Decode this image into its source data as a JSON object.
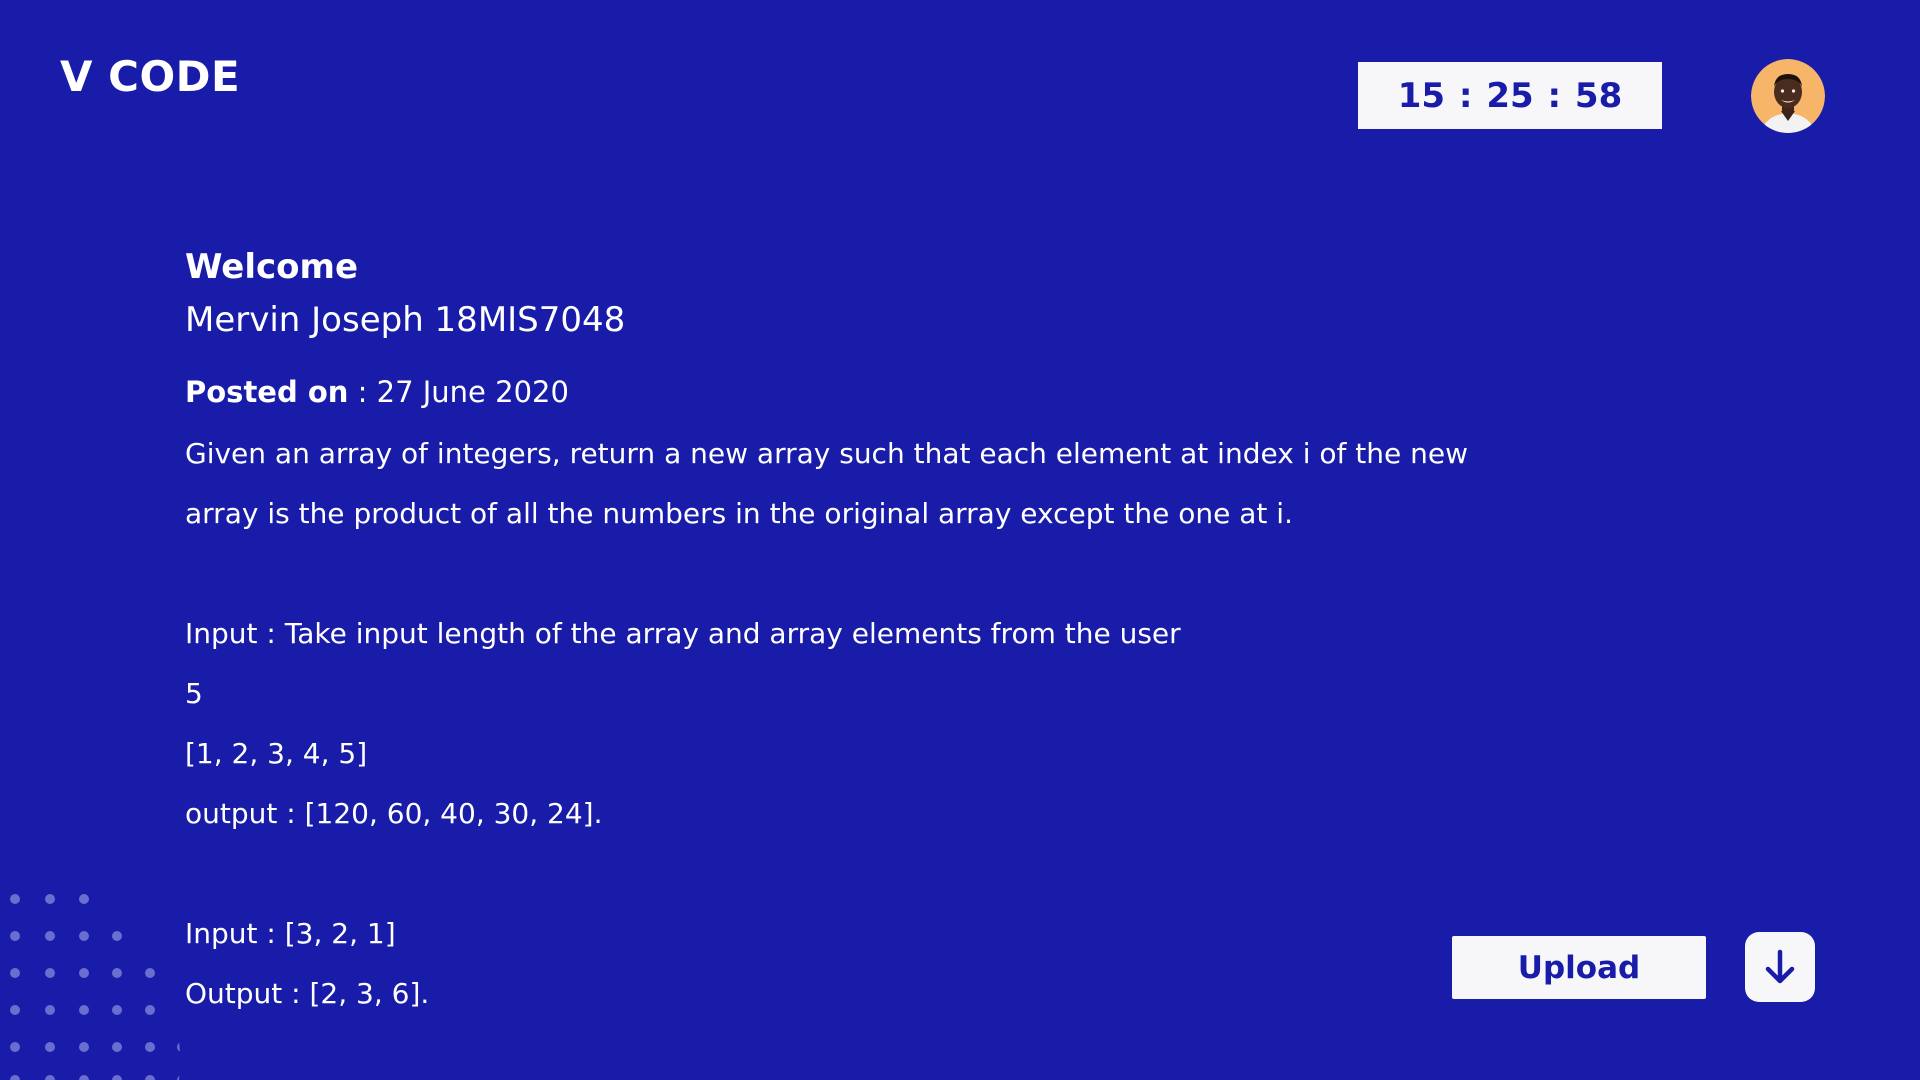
{
  "header": {
    "logo": "V CODE",
    "timer": "15 : 25 : 58"
  },
  "welcome": {
    "heading": "Welcome",
    "user": "Mervin Joseph 18MIS7048"
  },
  "posted": {
    "label": "Posted on",
    "separator": " : ",
    "date": "27 June 2020"
  },
  "problem": {
    "lines": [
      "Given an array of integers, return a new array such that each element at index i of the new",
      "array is the product of all the numbers in the original array except the one at i.",
      "",
      "Input : Take input length of the array and array elements from the user",
      "5",
      "[1, 2, 3, 4, 5]",
      "output : [120, 60, 40, 30, 24].",
      "",
      "Input : [3, 2, 1]",
      "Output : [2, 3, 6]."
    ]
  },
  "actions": {
    "upload_label": "Upload",
    "download_icon": "arrow-down-icon"
  },
  "colors": {
    "background": "#181ca9",
    "surface": "#f7f7fa",
    "text": "#ffffff",
    "accent_text": "#181ca9",
    "avatar_bg": "#f7b56a"
  }
}
